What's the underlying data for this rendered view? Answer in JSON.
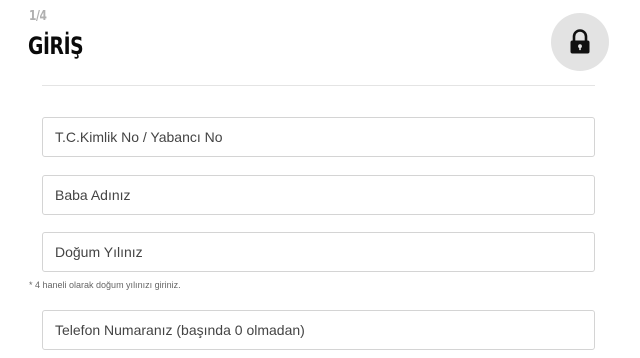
{
  "header": {
    "step": "1/4",
    "title": "GİRİŞ",
    "lock_icon": "lock-icon"
  },
  "form": {
    "tc_kimlik": {
      "placeholder": "T.C.Kimlik No / Yabancı No",
      "value": ""
    },
    "father_name": {
      "placeholder": "Baba Adınız",
      "value": ""
    },
    "birth_year": {
      "placeholder": "Doğum Yılınız",
      "value": ""
    },
    "birth_year_hint": "* 4 haneli olarak doğum yılınızı giriniz.",
    "phone": {
      "placeholder": "Telefon Numaranız (başında 0 olmadan)",
      "value": ""
    }
  },
  "colors": {
    "lock_button_bg": "#e3e3e3",
    "field_border": "#d4d4d4",
    "step_text": "#b0b0b0",
    "title_text": "#0a0a0a"
  }
}
